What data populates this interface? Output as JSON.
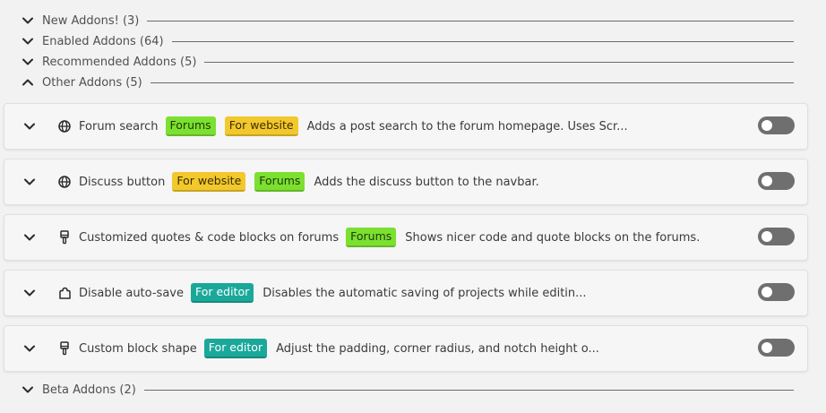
{
  "categories": {
    "new": {
      "label": "New Addons! (3)",
      "expanded": false
    },
    "enabled": {
      "label": "Enabled Addons (64)",
      "expanded": false
    },
    "recommended": {
      "label": "Recommended Addons (5)",
      "expanded": false
    },
    "other": {
      "label": "Other Addons (5)",
      "expanded": true
    },
    "beta": {
      "label": "Beta Addons (2)",
      "expanded": false
    }
  },
  "addons": [
    {
      "name": "Forum search",
      "icon": "globe-icon",
      "tags": [
        "Forums",
        "For website"
      ],
      "description": "Adds a post search to the forum homepage. Uses Scr...",
      "enabled": false
    },
    {
      "name": "Discuss button",
      "icon": "globe-icon",
      "tags": [
        "For website",
        "Forums"
      ],
      "description": "Adds the discuss button to the navbar.",
      "enabled": false
    },
    {
      "name": "Customized quotes & code blocks on forums",
      "icon": "brush-icon",
      "tags": [
        "Forums"
      ],
      "description": "Shows nicer code and quote blocks on the forums.",
      "enabled": false
    },
    {
      "name": "Disable auto-save",
      "icon": "puzzle-icon",
      "tags": [
        "For editor"
      ],
      "description": "Disables the automatic saving of projects while editin...",
      "enabled": false
    },
    {
      "name": "Custom block shape",
      "icon": "brush-icon",
      "tags": [
        "For editor"
      ],
      "description": "Adjust the padding, corner radius, and notch height o...",
      "enabled": false
    }
  ],
  "colors": {
    "tag_forums": "#7be02f",
    "tag_website": "#f2c82c",
    "tag_editor": "#1aa89a",
    "toggle_off": "#6f6f6f"
  }
}
